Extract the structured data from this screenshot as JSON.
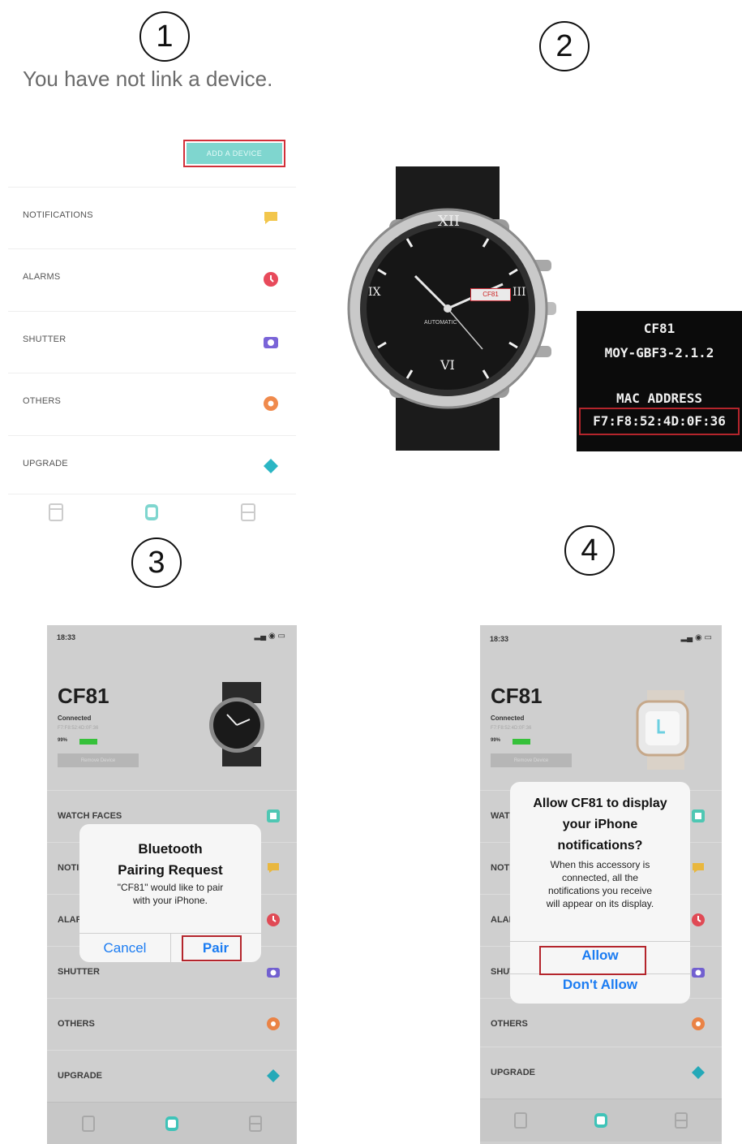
{
  "steps": [
    "1",
    "2",
    "3",
    "4"
  ],
  "panel1": {
    "title": "You have not link a device.",
    "add_button": "ADD A DEVICE",
    "menu": [
      {
        "label": "NOTIFICATIONS",
        "icon": "message-icon",
        "color": "#f2c64c"
      },
      {
        "label": "ALARMS",
        "icon": "clock-icon",
        "color": "#e84a5b"
      },
      {
        "label": "SHUTTER",
        "icon": "camera-icon",
        "color": "#7a64d8"
      },
      {
        "label": "OTHERS",
        "icon": "settings-icon",
        "color": "#f08a4c"
      },
      {
        "label": "UPGRADE",
        "icon": "diamond-icon",
        "color": "#2bb6c4"
      }
    ],
    "tabs": [
      "device-tab-icon",
      "watch-tab-icon",
      "profile-tab-icon"
    ]
  },
  "panel2": {
    "watch_dial_numerals": [
      "XII",
      "III",
      "VI",
      "IX"
    ],
    "watch_dial_text": "AUTOMATIC",
    "watch_date": "CF81",
    "device_name": "CF81",
    "firmware": "MOY-GBF3-2.1.2",
    "mac_label": "MAC ADDRESS",
    "mac_value": "F7:F8:52:4D:0F:36"
  },
  "panel3": {
    "time": "18:33",
    "device_name": "CF81",
    "status": "Connected",
    "mac": "F7:F8:52:4D:0F:36",
    "battery": "99%",
    "remove_button": "Remove Device",
    "menu": [
      "WATCH FACES",
      "NOTIFICATIONS",
      "ALARMS",
      "SHUTTER",
      "OTHERS",
      "UPGRADE"
    ],
    "alert": {
      "title_line1": "Bluetooth",
      "title_line2": "Pairing Request",
      "message_line1": "\"CF81\" would like to pair",
      "message_line2": "with your iPhone.",
      "cancel": "Cancel",
      "confirm": "Pair"
    }
  },
  "panel4": {
    "time": "18:33",
    "device_name": "CF81",
    "status": "Connected",
    "mac": "F7:F8:52:4D:0F:36",
    "battery": "99%",
    "remove_button": "Remove Device",
    "menu": [
      "WATCH FACES",
      "NOTIFICATIONS",
      "ALARMS",
      "SHUTTER",
      "OTHERS",
      "UPGRADE"
    ],
    "alert": {
      "title_line1": "Allow CF81 to display",
      "title_line2": "your iPhone",
      "title_line3": "notifications?",
      "message_line1": "When this accessory is",
      "message_line2": "connected, all the",
      "message_line3": "notifications you receive",
      "message_line4": "will appear on its display.",
      "allow": "Allow",
      "deny": "Don't Allow"
    }
  },
  "colors": {
    "highlight": "#b4252c",
    "ios_blue": "#1b7cf2",
    "teal": "#7fd6cf"
  }
}
